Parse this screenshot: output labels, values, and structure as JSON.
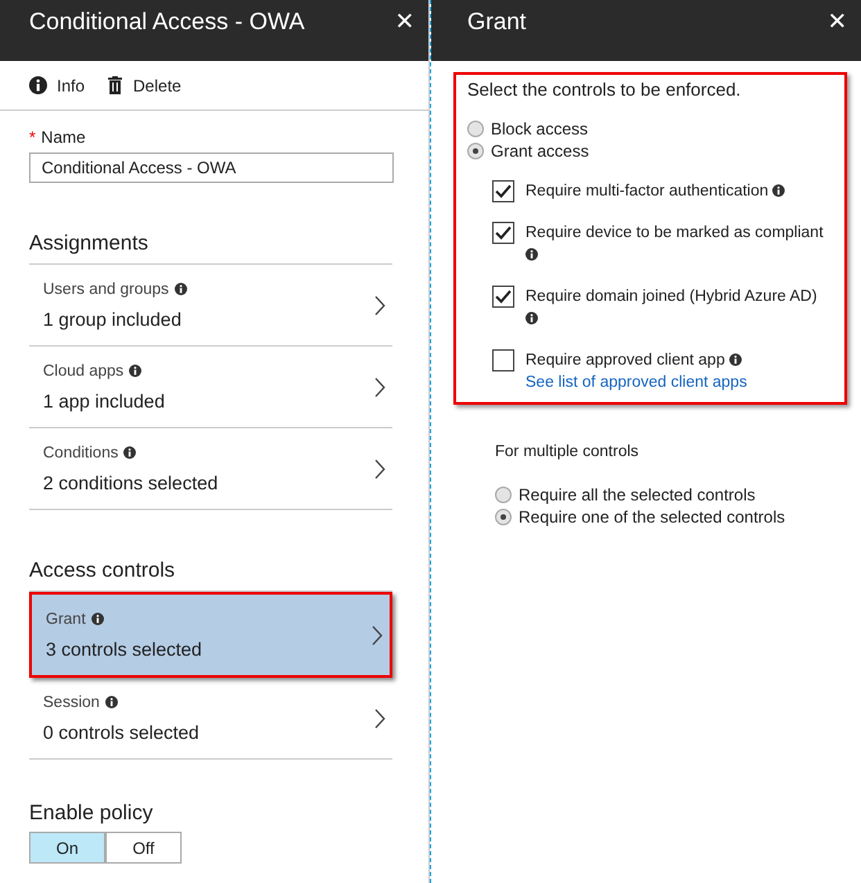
{
  "left_panel": {
    "title": "Conditional Access - OWA",
    "close": "✕",
    "toolbar": [
      {
        "kind": "info",
        "label": "Info"
      },
      {
        "kind": "trash",
        "label": "Delete"
      }
    ],
    "name_field": {
      "required_mark": "*",
      "label": "Name",
      "value": "Conditional Access - OWA"
    },
    "sections": [
      {
        "heading": "Assignments",
        "items": [
          {
            "label": "Users and groups",
            "value": "1 group included",
            "selected": false
          },
          {
            "label": "Cloud apps",
            "value": "1 app included",
            "selected": false
          },
          {
            "label": "Conditions",
            "value": "2 conditions selected",
            "selected": false
          }
        ]
      },
      {
        "heading": "Access controls",
        "items": [
          {
            "label": "Grant",
            "value": "3 controls selected",
            "selected": true
          },
          {
            "label": "Session",
            "value": "0 controls selected",
            "selected": false
          }
        ]
      }
    ],
    "enable_policy": {
      "label": "Enable policy",
      "options": [
        {
          "label": "On",
          "selected": true
        },
        {
          "label": "Off",
          "selected": false
        }
      ]
    }
  },
  "right_panel": {
    "title": "Grant",
    "close": "✕",
    "instruction": "Select the controls to be enforced.",
    "access_options": [
      {
        "label": "Block access",
        "selected": false
      },
      {
        "label": "Grant access",
        "selected": true
      }
    ],
    "requirements": [
      {
        "label": "Require multi-factor authentication",
        "checked": true
      },
      {
        "label": "Require device to be marked as compliant",
        "checked": true
      },
      {
        "label": "Require domain joined (Hybrid Azure AD)",
        "checked": true
      },
      {
        "label": "Require approved client app",
        "checked": false,
        "link": "See list of approved client apps"
      }
    ],
    "multiple_controls": {
      "label": "For multiple controls",
      "options": [
        {
          "label": "Require all the selected controls",
          "selected": false
        },
        {
          "label": "Require one of the selected controls",
          "selected": true
        }
      ]
    }
  }
}
